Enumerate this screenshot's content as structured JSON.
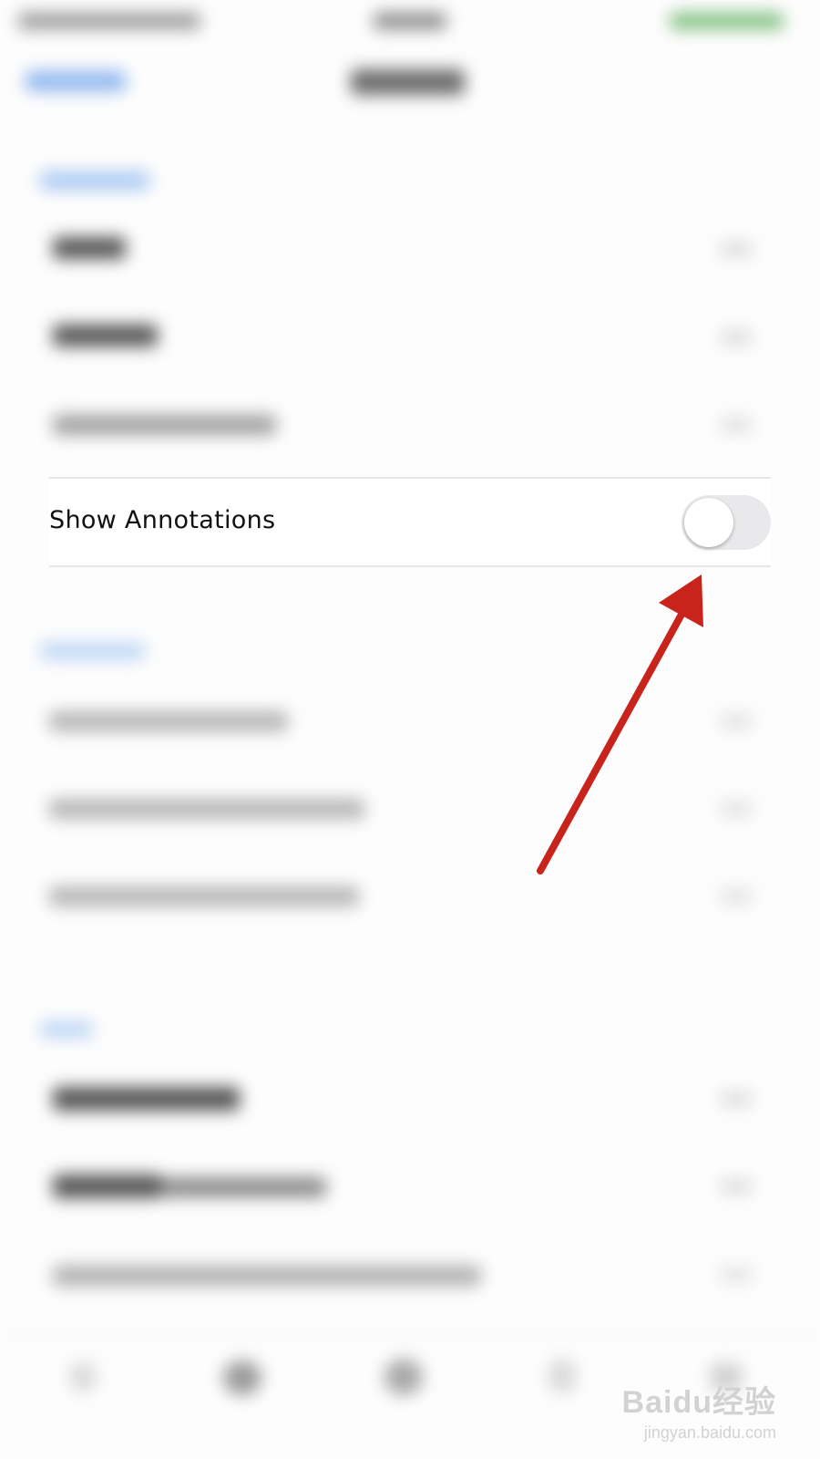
{
  "settings": {
    "annotations_row": {
      "label": "Show Annotations",
      "toggle_on": false
    }
  },
  "colors": {
    "accent": "#007aff",
    "toggle_off_track": "#e9e9eb",
    "arrow": "#c8241c"
  },
  "watermark": {
    "logo_text": "Baidu经验",
    "url": "jingyan.baidu.com"
  }
}
